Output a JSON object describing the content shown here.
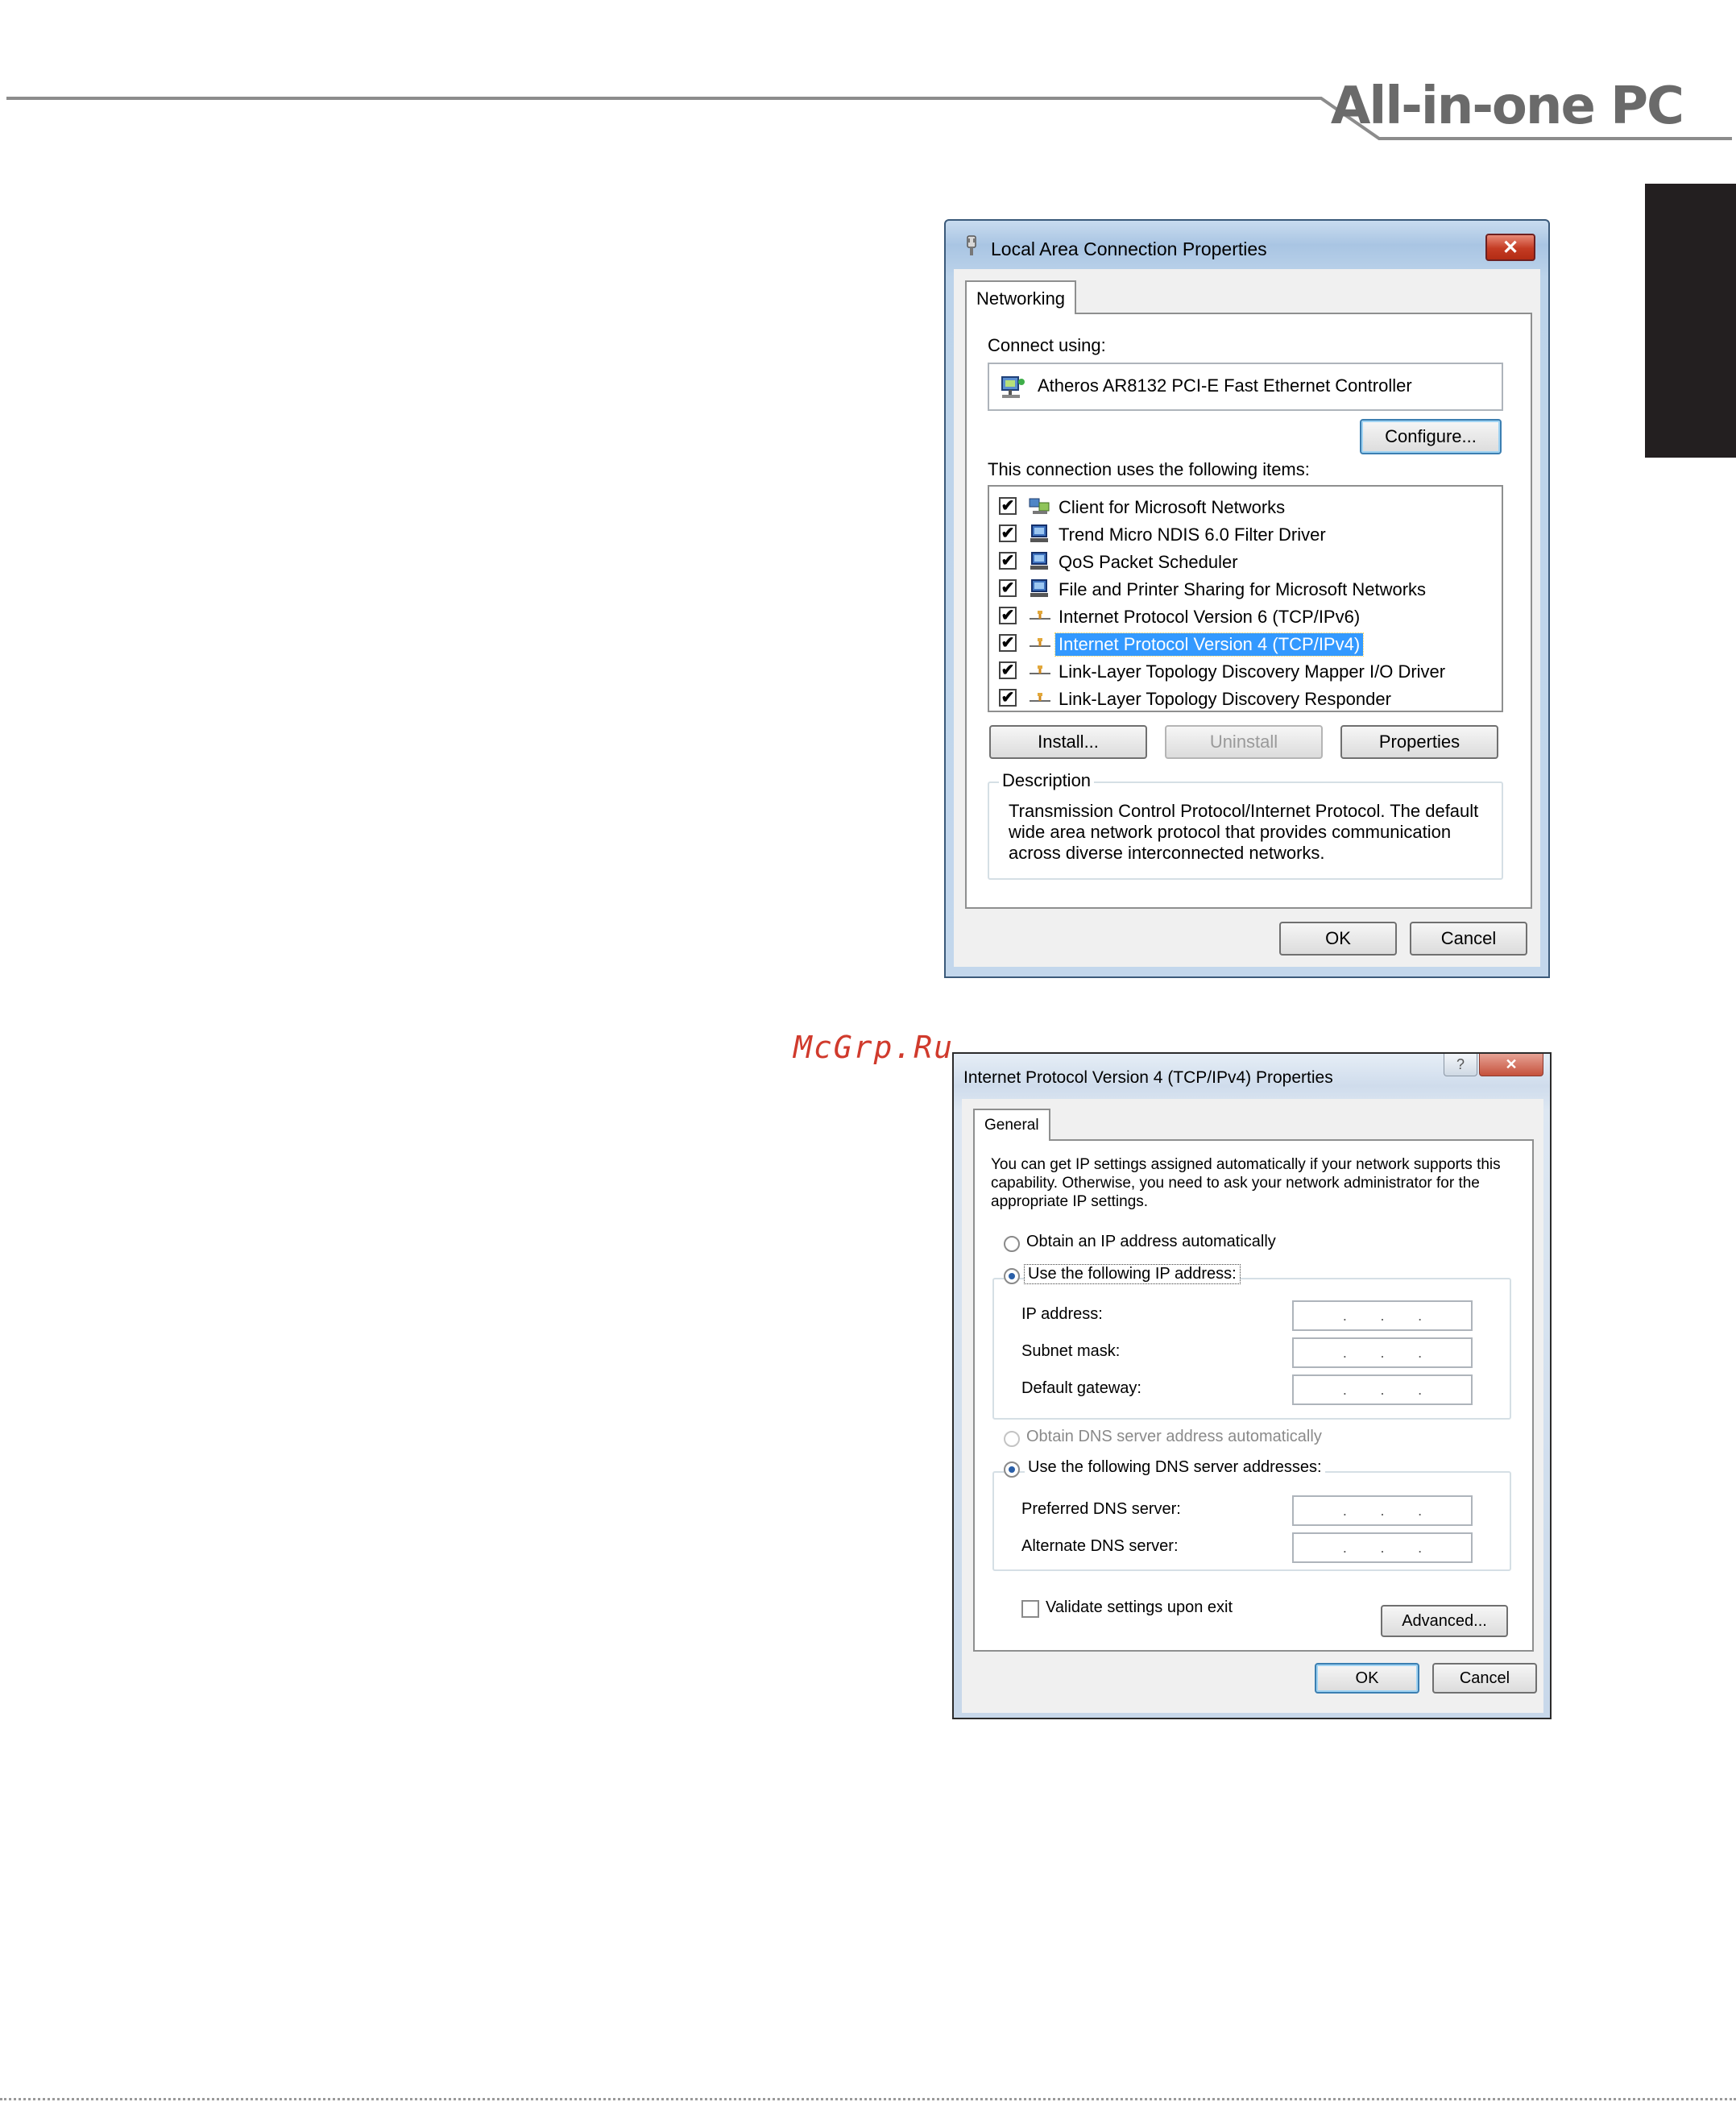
{
  "page": {
    "brand": "All-in-one PC",
    "watermark": "McGrp.Ru"
  },
  "dialog1": {
    "title": "Local Area Connection Properties",
    "close_glyph": "✕",
    "tab": "Networking",
    "connect_using_label": "Connect using:",
    "adapter_name": "Atheros AR8132 PCI-E Fast Ethernet Controller",
    "configure_button": "Configure...",
    "items_label": "This connection uses the following items:",
    "items": [
      {
        "label": "Client for Microsoft Networks",
        "checked": true,
        "icon": "network-client-icon"
      },
      {
        "label": "Trend Micro NDIS 6.0 Filter Driver",
        "checked": true,
        "icon": "network-service-icon"
      },
      {
        "label": "QoS Packet Scheduler",
        "checked": true,
        "icon": "network-service-icon"
      },
      {
        "label": "File and Printer Sharing for Microsoft Networks",
        "checked": true,
        "icon": "network-service-icon"
      },
      {
        "label": "Internet Protocol Version 6 (TCP/IPv6)",
        "checked": true,
        "icon": "protocol-icon"
      },
      {
        "label": "Internet Protocol Version 4 (TCP/IPv4)",
        "checked": true,
        "icon": "protocol-icon",
        "selected": true
      },
      {
        "label": "Link-Layer Topology Discovery Mapper I/O Driver",
        "checked": true,
        "icon": "protocol-icon"
      },
      {
        "label": "Link-Layer Topology Discovery Responder",
        "checked": true,
        "icon": "protocol-icon"
      }
    ],
    "check_glyph": "✔",
    "install_button": "Install...",
    "uninstall_button": "Uninstall",
    "properties_button": "Properties",
    "description_label": "Description",
    "description_text": "Transmission Control Protocol/Internet Protocol. The default wide area network protocol that provides communication across diverse interconnected networks.",
    "ok_button": "OK",
    "cancel_button": "Cancel"
  },
  "dialog2": {
    "title": "Internet Protocol Version 4 (TCP/IPv4) Properties",
    "help_glyph": "?",
    "close_glyph": "✕",
    "tab": "General",
    "intro_text": "You can get IP settings assigned automatically if your network supports this capability. Otherwise, you need to ask your network administrator for the appropriate IP settings.",
    "obtain_ip_auto": "Obtain an IP address automatically",
    "use_following_ip": "Use the following IP address:",
    "ip_address_label": "IP address:",
    "subnet_mask_label": "Subnet mask:",
    "default_gateway_label": "Default gateway:",
    "obtain_dns_auto": "Obtain DNS server address automatically",
    "use_following_dns": "Use the following DNS server addresses:",
    "preferred_dns_label": "Preferred DNS server:",
    "alternate_dns_label": "Alternate DNS server:",
    "ip_dot": ".",
    "validate_label": "Validate settings upon exit",
    "validate_checked": false,
    "advanced_button": "Advanced...",
    "ok_button": "OK",
    "cancel_button": "Cancel",
    "selected_ip_option": "use_following_ip",
    "selected_dns_option": "use_following_dns"
  },
  "colors": {
    "accent_selection": "#3399ff",
    "side_tab": "#231f20",
    "watermark": "#d03a2c",
    "brand_text": "#6a6a6a"
  }
}
